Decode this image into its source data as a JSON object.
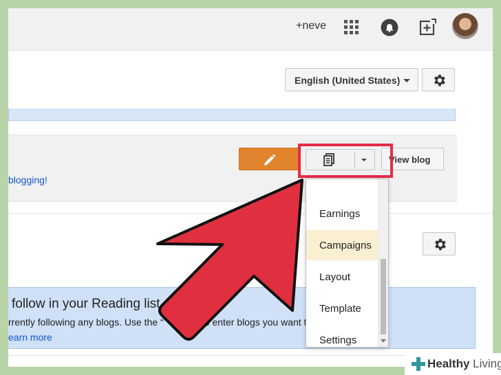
{
  "header": {
    "plus_user": "+neve",
    "icons": [
      "apps-grid-icon",
      "notifications-icon",
      "share-icon"
    ]
  },
  "settings": {
    "language": "English (United States)"
  },
  "blog": {
    "start_link": "blogging!",
    "view_blog_label": "View blog"
  },
  "posts_menu": {
    "items": [
      {
        "label": "Earnings"
      },
      {
        "label": "Campaigns"
      },
      {
        "label": "Layout"
      },
      {
        "label": "Template"
      },
      {
        "label": "Settings"
      }
    ],
    "active_index": 1
  },
  "reading_list": {
    "title": "follow in your Reading list",
    "text": "rrently following any blogs. Use the “     ” button to enter blogs you want to follow in your",
    "learn_more": "earn more"
  },
  "watermark": {
    "word1": "Healthy",
    "word2": "Living"
  },
  "colors": {
    "accent_red": "#e32d45",
    "edit_orange": "#e1832d",
    "link_blue": "#1155cc",
    "menu_active": "#fbefd2",
    "outer_frame": "#b9d3a9"
  }
}
